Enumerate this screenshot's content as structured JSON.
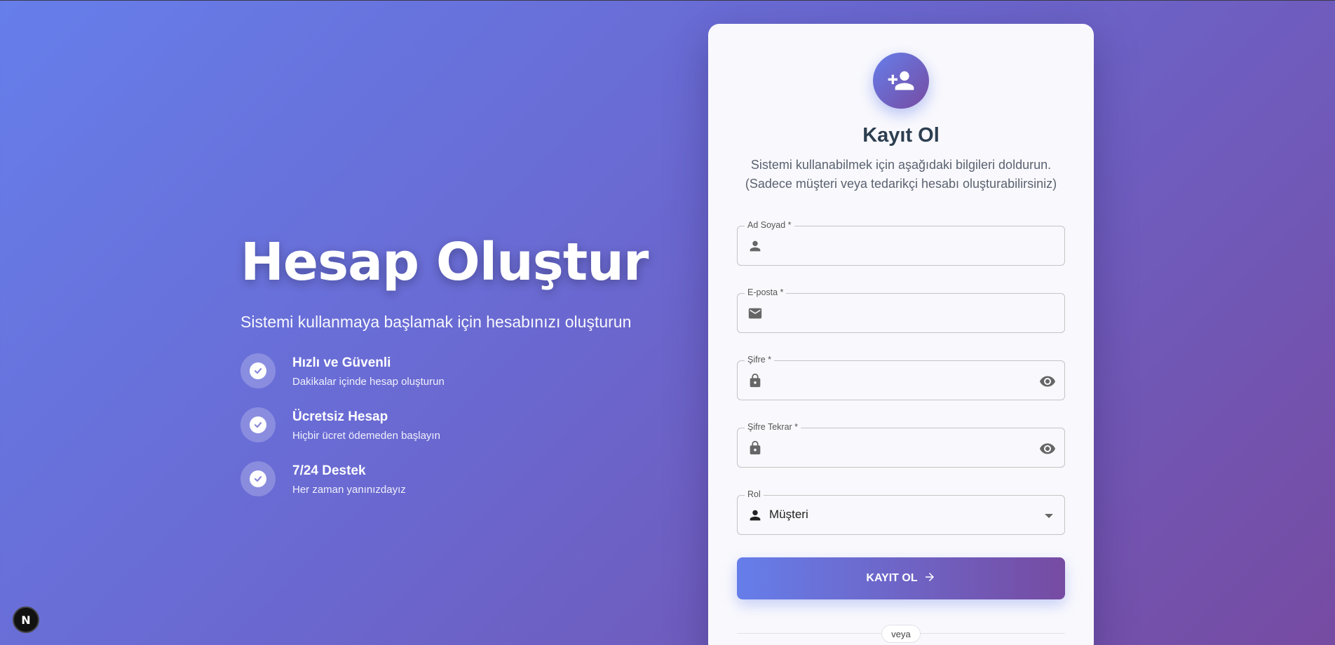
{
  "hero": {
    "title": "Hesap Oluştur",
    "subtitle": "Sistemi kullanmaya başlamak için hesabınızı oluşturun",
    "features": [
      {
        "title": "Hızlı ve Güvenli",
        "desc": "Dakikalar içinde hesap oluşturun",
        "icon": "check-circle-icon"
      },
      {
        "title": "Ücretsiz Hesap",
        "desc": "Hiçbir ücret ödemeden başlayın",
        "icon": "check-circle-icon"
      },
      {
        "title": "7/24 Destek",
        "desc": "Her zaman yanınızdayız",
        "icon": "check-circle-icon"
      }
    ]
  },
  "form": {
    "icon": "person-add-icon",
    "title": "Kayıt Ol",
    "description_line1": "Sistemi kullanabilmek için aşağıdaki bilgileri doldurun.",
    "description_line2": "(Sadece müşteri veya tedarikçi hesabı oluşturabilirsiniz)",
    "fields": {
      "name": {
        "label": "Ad Soyad *",
        "value": "",
        "icon": "person-icon"
      },
      "email": {
        "label": "E-posta *",
        "value": "",
        "icon": "mail-icon"
      },
      "password": {
        "label": "Şifre *",
        "value": "",
        "icon": "lock-icon",
        "toggle_icon": "eye-icon"
      },
      "password_confirm": {
        "label": "Şifre Tekrar *",
        "value": "",
        "icon": "lock-icon",
        "toggle_icon": "eye-icon"
      },
      "role": {
        "label": "Rol",
        "value": "Müşteri",
        "icon": "person-icon"
      }
    },
    "submit_label": "KAYIT OL",
    "divider_label": "veya"
  },
  "dev_badge": {
    "label": "N"
  },
  "colors": {
    "gradient_start": "#667eea",
    "gradient_end": "#764ba2",
    "card_bg": "#f9f9fd",
    "title": "#2c3e50"
  }
}
